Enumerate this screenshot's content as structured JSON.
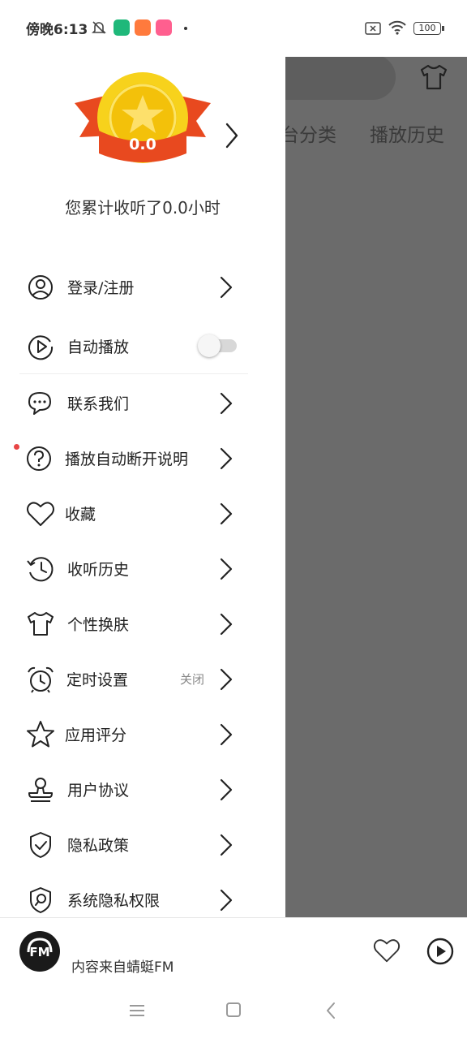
{
  "status_bar": {
    "time": "傍晚6:13",
    "battery": "100",
    "app_icon_colors": [
      "#1fb87a",
      "#ff7a3d",
      "#ff5f8f"
    ]
  },
  "background": {
    "tabs": [
      "台分类",
      "播放历史"
    ]
  },
  "drawer": {
    "medal_value": "0.0",
    "listen_text": "您累计收听了0.0小时",
    "menu": [
      {
        "label": "登录/注册",
        "icon": "user-circle-icon"
      },
      {
        "label": "自动播放",
        "icon": "play-circle-icon",
        "toggle": false
      },
      {
        "label": "联系我们",
        "icon": "chat-bubbles-icon"
      },
      {
        "label": "播放自动断开说明",
        "icon": "question-circle-icon",
        "dot": true
      },
      {
        "label": "收藏",
        "icon": "heart-icon"
      },
      {
        "label": "收听历史",
        "icon": "history-icon"
      },
      {
        "label": "个性换肤",
        "icon": "tshirt-icon"
      },
      {
        "label": "定时设置",
        "icon": "alarm-clock-icon",
        "extra": "关闭"
      },
      {
        "label": "应用评分",
        "icon": "star-icon"
      },
      {
        "label": "用户协议",
        "icon": "stamp-icon"
      },
      {
        "label": "隐私政策",
        "icon": "shield-check-icon"
      },
      {
        "label": "系统隐私权限",
        "icon": "shield-search-icon"
      }
    ]
  },
  "player": {
    "logo_text": "FM",
    "text": "内容来自蜻蜓FM"
  },
  "colors": {
    "overlay": "#6b6b6b",
    "medal_gold": "#f7d21c",
    "ribbon_red": "#e8491f",
    "dot_red": "#e84545"
  }
}
